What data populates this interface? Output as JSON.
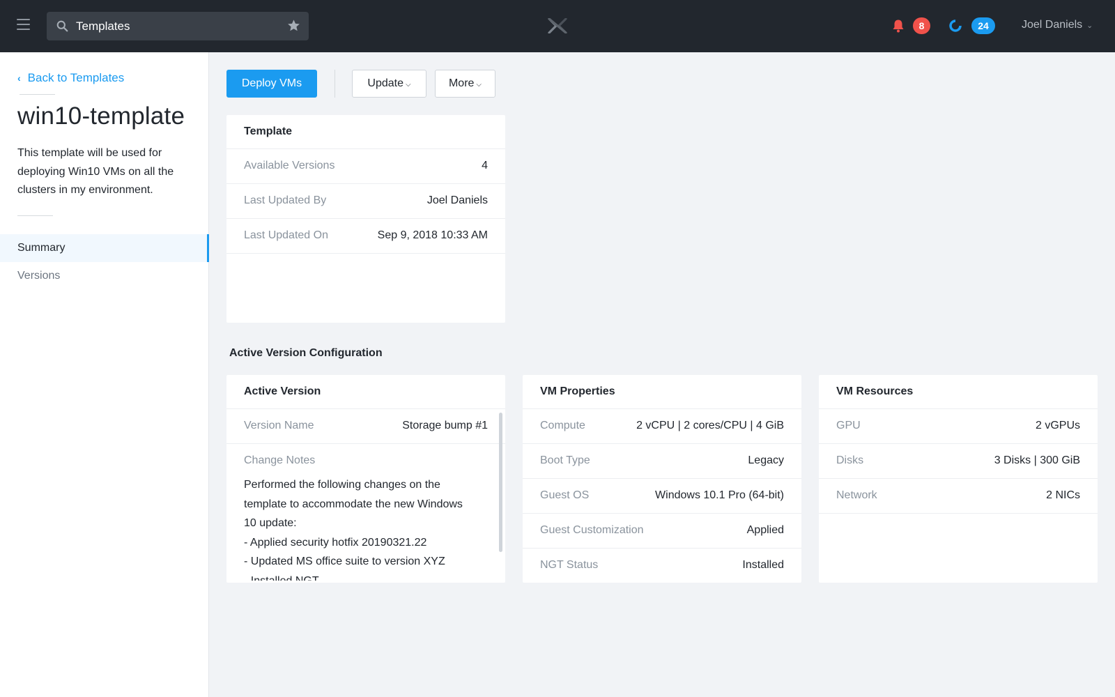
{
  "topbar": {
    "search_value": "Templates",
    "alert_count": "8",
    "task_count": "24",
    "user_name": "Joel Daniels",
    "colors": {
      "bar": "#22272e",
      "alert": "#f0524b",
      "accent": "#1b9bf0"
    }
  },
  "sidebar": {
    "back_label": "Back to Templates",
    "title": "win10-template",
    "description": "This template will be used for deploying Win10 VMs on all the clusters in my environment.",
    "nav": [
      {
        "label": "Summary",
        "active": true
      },
      {
        "label": "Versions",
        "active": false
      }
    ]
  },
  "toolbar": {
    "deploy_label": "Deploy VMs",
    "update_label": "Update",
    "more_label": "More"
  },
  "template_card": {
    "title": "Template",
    "rows": [
      {
        "key": "Available Versions",
        "value": "4"
      },
      {
        "key": "Last Updated By",
        "value": "Joel Daniels"
      },
      {
        "key": "Last Updated On",
        "value": "Sep 9, 2018 10:33 AM"
      }
    ]
  },
  "section_title": "Active Version Configuration",
  "active_version": {
    "title": "Active Version",
    "version_name_key": "Version Name",
    "version_name_value": "Storage bump #1",
    "change_notes_key": "Change Notes",
    "change_notes_lines": [
      "Performed the following changes on the",
      "template to accommodate the new Windows",
      "10 update:",
      "- Applied security hotfix 20190321.22",
      "- Updated MS office suite to version XYZ",
      "- Installed NGT"
    ]
  },
  "vm_properties": {
    "title": "VM Properties",
    "rows": [
      {
        "key": "Compute",
        "value": "2 vCPU | 2 cores/CPU | 4 GiB"
      },
      {
        "key": "Boot Type",
        "value": "Legacy"
      },
      {
        "key": "Guest OS",
        "value": "Windows 10.1 Pro (64-bit)"
      },
      {
        "key": "Guest Customization",
        "value": "Applied"
      },
      {
        "key": "NGT Status",
        "value": "Installed"
      }
    ]
  },
  "vm_resources": {
    "title": "VM Resources",
    "rows": [
      {
        "key": "GPU",
        "value": "2 vGPUs"
      },
      {
        "key": "Disks",
        "value": "3 Disks | 300 GiB"
      },
      {
        "key": "Network",
        "value": "2 NICs"
      }
    ]
  }
}
